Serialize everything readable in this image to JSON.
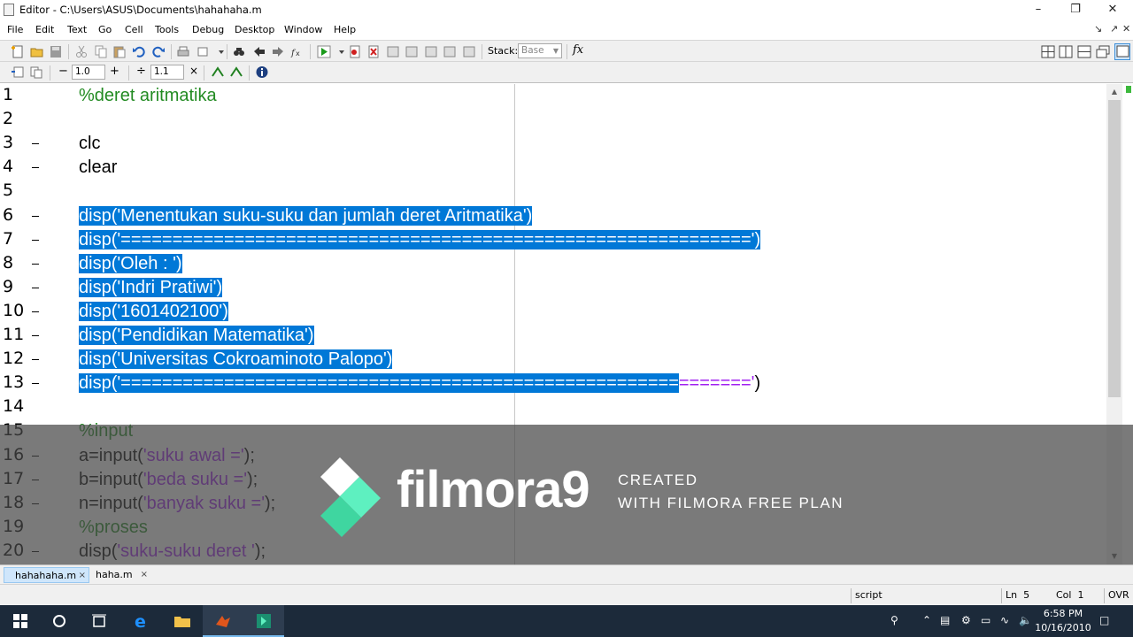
{
  "window": {
    "title": "Editor - C:\\Users\\ASUS\\Documents\\hahahaha.m"
  },
  "menu": [
    "File",
    "Edit",
    "Text",
    "Go",
    "Cell",
    "Tools",
    "Debug",
    "Desktop",
    "Window",
    "Help"
  ],
  "toolbar": {
    "stack_label": "Stack:",
    "stack_value": "Base",
    "fx_label": "fx"
  },
  "cellbar": {
    "minus": "−",
    "plus": "+",
    "value1": "1.0",
    "divide": "÷",
    "value2": "1.1",
    "times": "×"
  },
  "code_lines": [
    {
      "num": "1",
      "text": "%deret aritmatika",
      "dash": false
    },
    {
      "num": "2",
      "text": "",
      "dash": false
    },
    {
      "num": "3",
      "text": "clc",
      "dash": true
    },
    {
      "num": "4",
      "text": "clear",
      "dash": true
    },
    {
      "num": "5",
      "text": "",
      "dash": false
    },
    {
      "num": "6",
      "text": "disp('Menentukan suku-suku dan jumlah deret Aritmatika')",
      "dash": true
    },
    {
      "num": "7",
      "text": "disp('=============================================================')",
      "dash": true
    },
    {
      "num": "8",
      "text": "disp('Oleh : ')",
      "dash": true
    },
    {
      "num": "9",
      "text": "disp('Indri Pratiwi')",
      "dash": true
    },
    {
      "num": "10",
      "text": "disp('1601402100')",
      "dash": true
    },
    {
      "num": "11",
      "text": "disp('Pendidikan Matematika')",
      "dash": true
    },
    {
      "num": "12",
      "text": "disp('Universitas Cokroaminoto Palopo')",
      "dash": true
    },
    {
      "num": "13",
      "text": "disp('=============================================================')",
      "dash": true
    },
    {
      "num": "14",
      "text": "",
      "dash": false
    },
    {
      "num": "15",
      "text": "%input",
      "dash": false
    },
    {
      "num": "16",
      "text": "a=input('suku awal =');",
      "dash": true
    },
    {
      "num": "17",
      "text": "b=input('beda suku =');",
      "dash": true
    },
    {
      "num": "18",
      "text": "n=input('banyak suku =');",
      "dash": true
    },
    {
      "num": "19",
      "text": "%proses",
      "dash": false
    },
    {
      "num": "20",
      "text": "disp('suku-suku deret ');",
      "dash": true
    }
  ],
  "watermark": {
    "brand": "filmora",
    "version": "9",
    "line1": "CREATED",
    "line2": "WITH FILMORA FREE PLAN"
  },
  "tabs": [
    {
      "label": "hahahaha.m",
      "active": true
    },
    {
      "label": "haha.m",
      "active": false
    }
  ],
  "tab_close": "×",
  "status": {
    "mode": "script",
    "ln_label": "Ln",
    "ln": "5",
    "col_label": "Col",
    "col": "1",
    "ovr": "OVR"
  },
  "taskbar": {
    "time": "6:58 PM",
    "date": "10/16/2010"
  },
  "colors": {
    "selection": "#0078d7",
    "comment": "#228b22",
    "string": "#a020f0",
    "taskbar": "#1c2a3a"
  }
}
